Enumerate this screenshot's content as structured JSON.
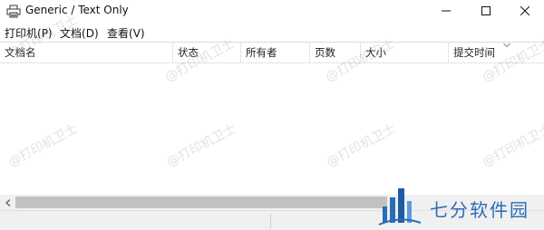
{
  "window": {
    "title": "Generic / Text Only",
    "icon": "printer-icon"
  },
  "menu": {
    "items": [
      {
        "label": "打印机",
        "key": "(P)",
        "underline": "P"
      },
      {
        "label": "文档",
        "key": "(D)",
        "underline": "D"
      },
      {
        "label": "查看",
        "key": "(V)",
        "underline": "V"
      }
    ]
  },
  "columns": [
    "文档名",
    "状态",
    "所有者",
    "页数",
    "大小",
    "提交时间"
  ],
  "rows": [],
  "watermark": "@打印机卫士",
  "logo": {
    "text": "七分软件园",
    "color": "#2b6cb8"
  },
  "colors": {
    "scroll_thumb": "#c2c2c2",
    "chrome": "#f0f0f0"
  }
}
